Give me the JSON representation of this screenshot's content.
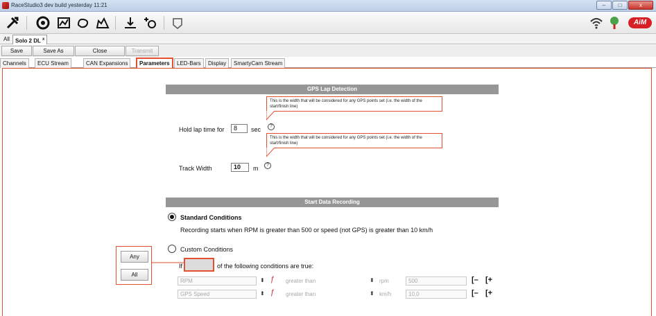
{
  "window": {
    "title": "RaceStudio3 dev  build yesterday 11:21",
    "controls": [
      "–",
      "□",
      "x"
    ]
  },
  "doc_tabs": {
    "all_label": "All",
    "active_tab": "Solo 2 DL",
    "active_tab_mark": "x"
  },
  "actions": {
    "save": "Save",
    "save_as": "Save As",
    "close": "Close",
    "transmit": "Transmit"
  },
  "subtabs": [
    "Channels",
    "ECU Stream",
    "CAN Expansions",
    "Parameters",
    "LED-Bars",
    "Display",
    "SmartyCam Stream"
  ],
  "gps": {
    "header": "GPS Lap Detection",
    "tooltip_1": "This is the width that will be considered for any GPS points set (i.e. the width of the start/finish line)",
    "tooltip_2": "This is the width that will be considered for any GPS points set (i.e. the width of the start/finish line)",
    "hold_label": "Hold lap time for",
    "hold_value": "8",
    "hold_unit": "sec",
    "track_label": "Track Width",
    "track_value": "10",
    "track_unit": "m",
    "help_glyph": "?"
  },
  "recording": {
    "header": "Start Data Recording",
    "standard_label": "Standard Conditions",
    "standard_desc": "Recording starts when RPM is greater than 500 or speed (not GPS) is greater than 10 km/h",
    "custom_label": "Custom Conditions",
    "if_label": "If",
    "of_label": "of the following conditions are true:",
    "any_label": "Any",
    "all_label": "All",
    "rows": [
      {
        "channel": "RPM",
        "op": "greater than",
        "unit": "rpm",
        "value": "500"
      },
      {
        "channel": "GPS Speed",
        "op": "greater than",
        "unit": "km/h",
        "value": "10,0"
      }
    ],
    "minus_glyph": "[–",
    "plus_glyph": "[+"
  }
}
